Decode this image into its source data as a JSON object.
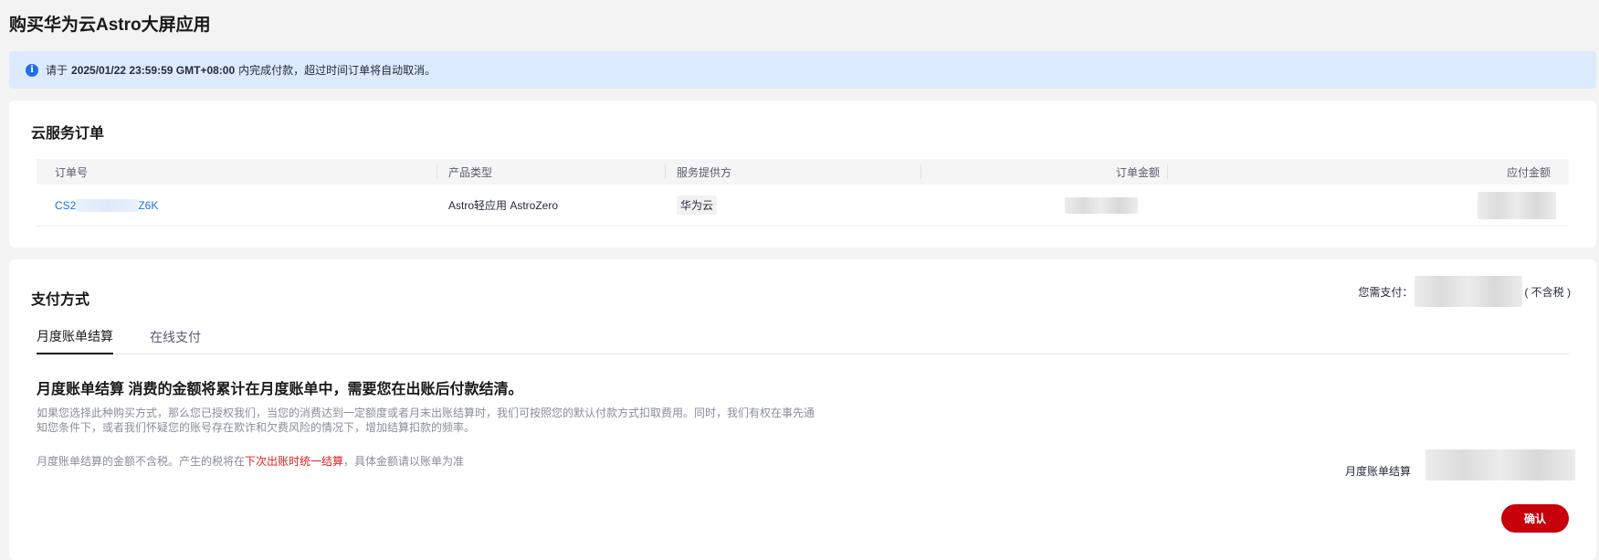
{
  "page": {
    "title": "购买华为云Astro大屏应用"
  },
  "notice": {
    "prefix": "请于",
    "deadline": "2025/01/22 23:59:59 GMT+08:00",
    "suffix": "内完成付款，超过时间订单将自动取消。"
  },
  "order": {
    "title": "云服务订单",
    "columns": [
      "订单号",
      "产品类型",
      "服务提供方",
      "订单金额",
      "应付金额"
    ],
    "rows": [
      {
        "order_id_start": "CS2",
        "order_id_end": "Z6K",
        "product": "Astro轻应用 AstroZero",
        "provider": "华为云"
      }
    ]
  },
  "payment": {
    "title": "支付方式",
    "need_pay_label": "您需支付：",
    "tax_label": "( 不含税 )",
    "tabs": [
      "月度账单结算",
      "在线支付"
    ],
    "heading": "月度账单结算 消费的金额将累计在月度账单中，需要您在出账后付款结清。",
    "description": "如果您选择此种购买方式，那么您已授权我们，当您的消费达到一定额度或者月末出账结算时，我们可按照您的默认付款方式扣取费用。同时，我们有权在事先通知您条件下，或者我们怀疑您的账号存在欺诈和欠费风险的情况下，增加结算扣款的频率。",
    "tax_note_before": "月度账单结算的金额不含税。产生的税将在",
    "tax_note_link": "下次出账时统一结算",
    "tax_note_after": "，具体金额请以账单为准",
    "monthly_label": "月度账单结算",
    "confirm": "确认"
  }
}
